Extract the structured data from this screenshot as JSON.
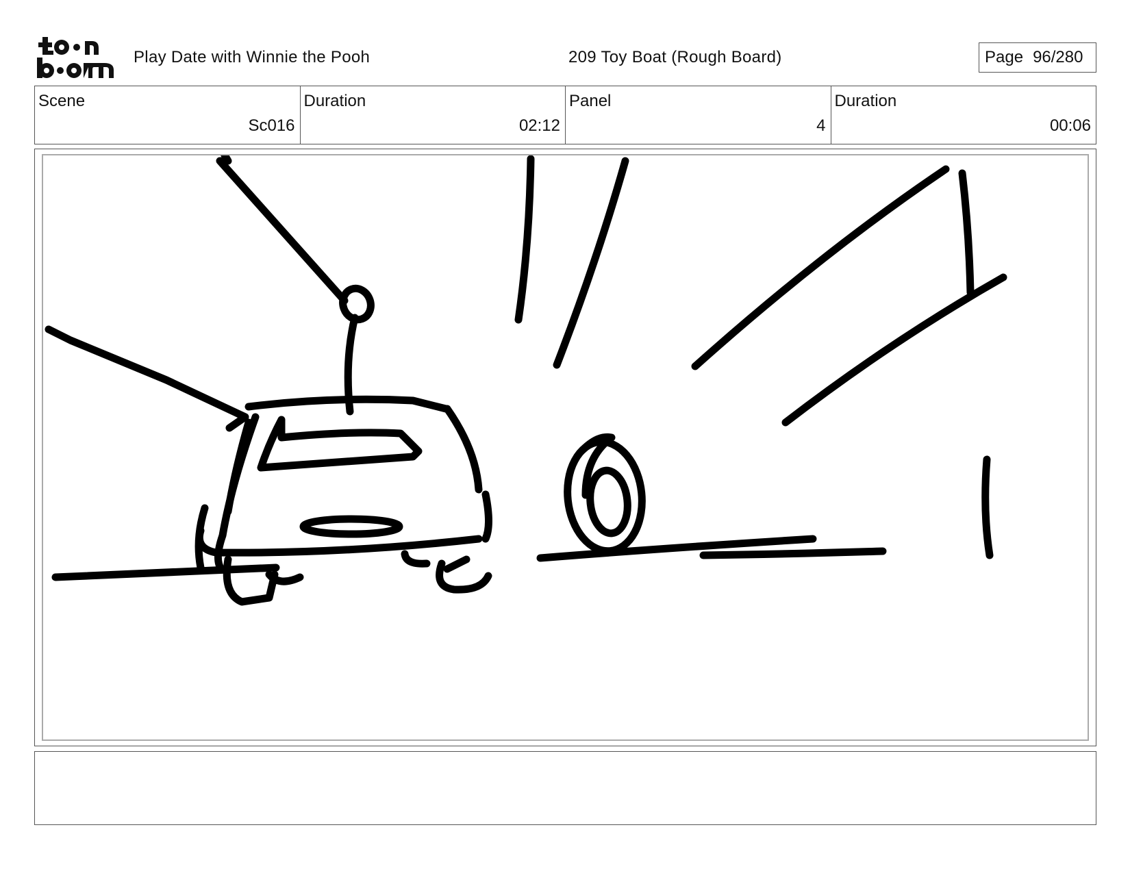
{
  "header": {
    "logo_text": "toon boom",
    "project_title": "Play Date with Winnie the Pooh",
    "board_title": "209 Toy Boat (Rough Board)",
    "page_label": "Page",
    "page_value": "96/280"
  },
  "info": {
    "scene_label": "Scene",
    "scene_value": "Sc016",
    "scene_duration_label": "Duration",
    "scene_duration_value": "02:12",
    "panel_label": "Panel",
    "panel_value": "4",
    "panel_duration_label": "Duration",
    "panel_duration_value": "00:06"
  },
  "panel": {
    "ink_color": "#000000"
  },
  "notes": {
    "text": ""
  }
}
